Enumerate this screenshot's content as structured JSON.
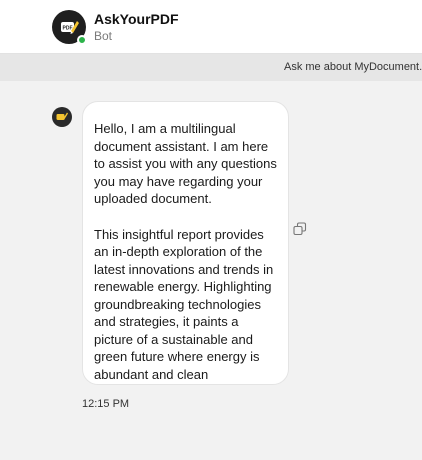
{
  "header": {
    "bot_name": "AskYourPDF",
    "bot_subtitle": "Bot",
    "avatar_icon": "pdf-logo-icon",
    "status_color": "#2bb34a"
  },
  "banner": {
    "text": "Ask me about MyDocument.pdf"
  },
  "conversation": {
    "messages": [
      {
        "sender": "bot",
        "paragraphs": [
          "Hello, I am a multilingual document assistant. I am here to assist you with any questions you may have regarding your uploaded document.",
          "This insightful report provides an in-depth exploration of the latest innovations and trends in renewable energy. Highlighting groundbreaking technologies and strategies, it paints a picture of a sustainable and green future where energy is abundant and clean"
        ],
        "time": "12:15 PM",
        "action_icon": "copy-icon"
      }
    ]
  },
  "colors": {
    "accent_yellow": "#f4c430",
    "background": "#f2f2f2",
    "bubble": "#ffffff"
  }
}
